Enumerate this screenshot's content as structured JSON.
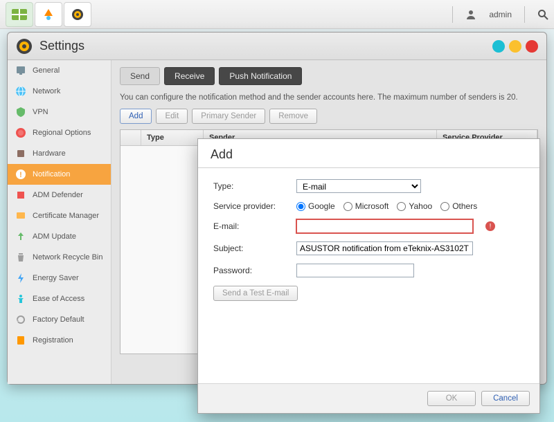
{
  "taskbar": {
    "user": "admin"
  },
  "window": {
    "title": "Settings",
    "sidebar": {
      "items": [
        {
          "label": "General"
        },
        {
          "label": "Network"
        },
        {
          "label": "VPN"
        },
        {
          "label": "Regional Options"
        },
        {
          "label": "Hardware"
        },
        {
          "label": "Notification"
        },
        {
          "label": "ADM Defender"
        },
        {
          "label": "Certificate Manager"
        },
        {
          "label": "ADM Update"
        },
        {
          "label": "Network Recycle Bin"
        },
        {
          "label": "Energy Saver"
        },
        {
          "label": "Ease of Access"
        },
        {
          "label": "Factory Default"
        },
        {
          "label": "Registration"
        }
      ]
    },
    "tabs": [
      {
        "label": "Send"
      },
      {
        "label": "Receive"
      },
      {
        "label": "Push Notification"
      }
    ],
    "description": "You can configure the notification method and the sender accounts here. The maximum number of senders is 20.",
    "actions": {
      "add": "Add",
      "edit": "Edit",
      "primary": "Primary Sender",
      "remove": "Remove"
    },
    "table": {
      "cols": {
        "type": "Type",
        "sender": "Sender",
        "provider": "Service Provider"
      }
    }
  },
  "modal": {
    "title": "Add",
    "labels": {
      "type": "Type:",
      "provider": "Service provider:",
      "email": "E-mail:",
      "subject": "Subject:",
      "password": "Password:"
    },
    "type_value": "E-mail",
    "providers": {
      "google": "Google",
      "microsoft": "Microsoft",
      "yahoo": "Yahoo",
      "others": "Others"
    },
    "email_value": "",
    "subject_value": "ASUSTOR notification from eTeknix-AS3102T",
    "password_value": "",
    "test_btn": "Send a Test E-mail",
    "ok": "OK",
    "cancel": "Cancel"
  }
}
